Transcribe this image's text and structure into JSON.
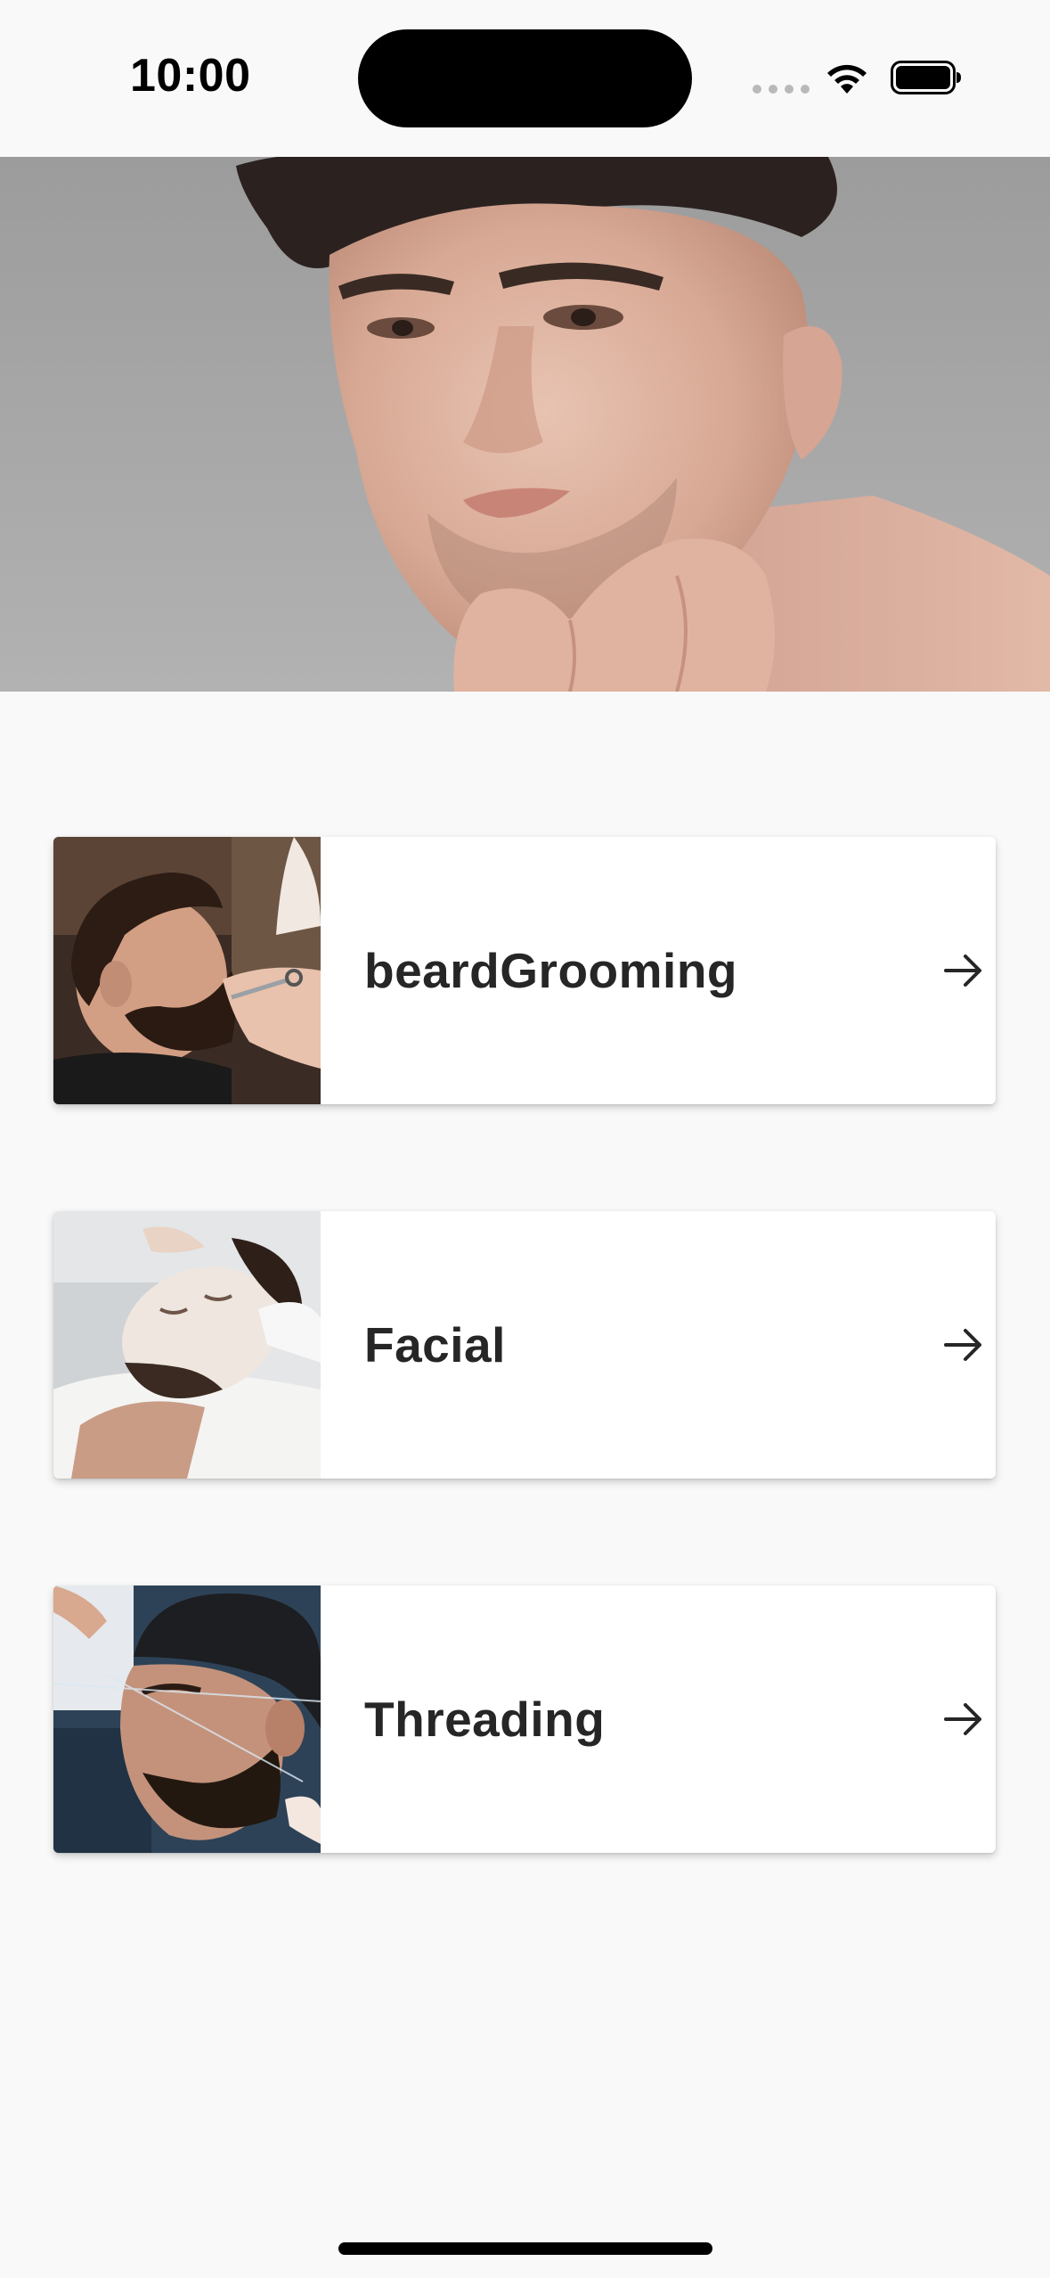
{
  "status_bar": {
    "time": "10:00",
    "icons": [
      "signal-dots-icon",
      "wifi-icon",
      "battery-icon"
    ]
  },
  "hero": {
    "image": "man-portrait-hero-image"
  },
  "services": [
    {
      "title": "beardGrooming",
      "thumbnail": "beard-grooming-image",
      "action_icon": "arrow-right-icon"
    },
    {
      "title": "Facial",
      "thumbnail": "facial-treatment-image",
      "action_icon": "arrow-right-icon"
    },
    {
      "title": "Threading",
      "thumbnail": "eyebrow-threading-image",
      "action_icon": "arrow-right-icon"
    }
  ],
  "colors": {
    "background": "#f9f9f9",
    "card": "#ffffff",
    "title_text": "#262626",
    "hero_backdrop": "#a3a3a3"
  }
}
